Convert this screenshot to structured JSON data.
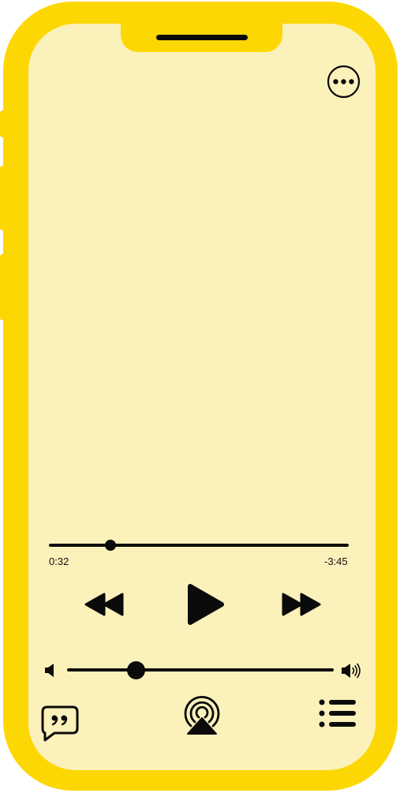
{
  "player": {
    "progress": {
      "elapsed": "0:32",
      "remaining": "-3:45",
      "fraction": 0.205
    },
    "volume": {
      "fraction": 0.26
    }
  },
  "icons": {
    "more": "more-options-icon",
    "rewind": "rewind-icon",
    "play": "play-icon",
    "fast_forward": "fast-forward-icon",
    "volume_low": "volume-low-icon",
    "volume_high": "volume-high-icon",
    "lyrics": "lyrics-icon",
    "airplay": "airplay-icon",
    "queue": "queue-list-icon"
  },
  "colors": {
    "frame": "#FCD703",
    "screen": "#FBF1BA",
    "ink": "#0b0b0b"
  }
}
